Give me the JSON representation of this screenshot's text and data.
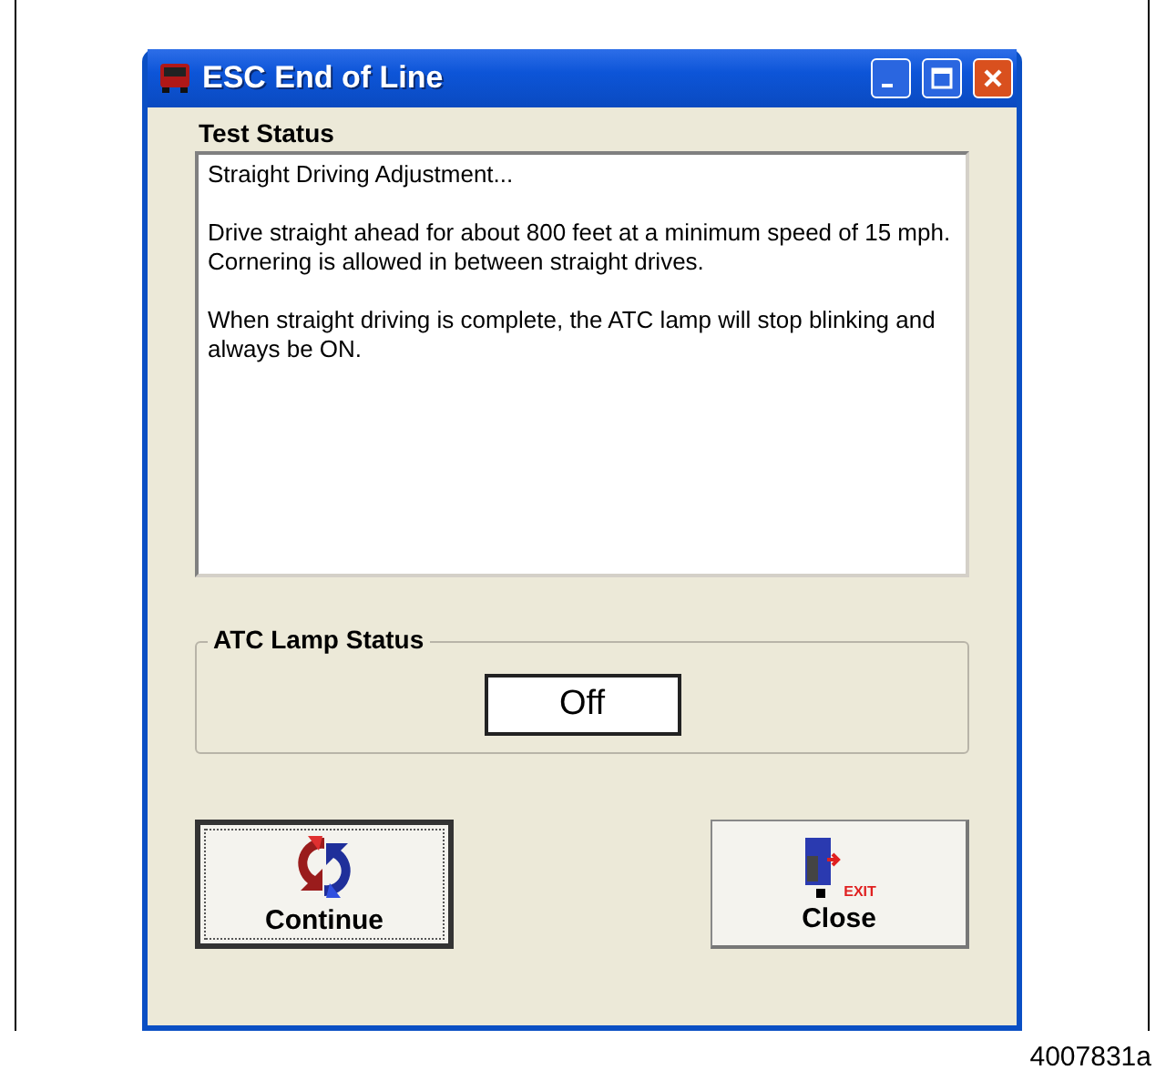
{
  "window": {
    "title": "ESC End of Line"
  },
  "test_status": {
    "label": "Test Status",
    "paragraphs": [
      "Straight Driving Adjustment...",
      "Drive straight ahead for about 800 feet at a minimum speed of 15 mph.  Cornering is allowed in between straight drives.",
      "When straight driving is complete, the ATC lamp will stop blinking and always be ON."
    ]
  },
  "atc_lamp_status": {
    "label": "ATC Lamp Status",
    "value": "Off"
  },
  "buttons": [
    {
      "kind": "continue",
      "label": "Continue",
      "focused": true
    },
    {
      "kind": "close",
      "label": "Close",
      "icon_text": "EXIT",
      "focused": false
    }
  ],
  "figure_caption": "4007831a"
}
